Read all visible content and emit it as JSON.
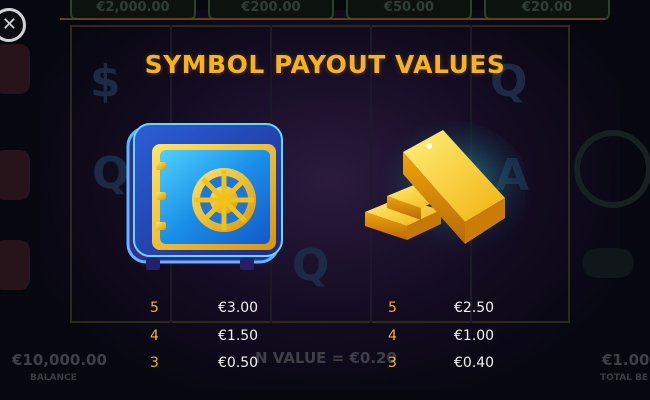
{
  "background": {
    "jackpots": [
      "€2,000.00",
      "€200.00",
      "€50.00",
      "€20.00"
    ],
    "balance_value": "€10,000.00",
    "balance_label": "BALANCE",
    "win_text": "N VALUE = €0.20",
    "total_bet_value": "€1.00",
    "total_bet_label": "TOTAL BE"
  },
  "overlay": {
    "title": "SYMBOL PAYOUT VALUES",
    "symbols": [
      {
        "icon": "safe-icon",
        "payouts": [
          {
            "count": "5",
            "value": "€3.00"
          },
          {
            "count": "4",
            "value": "€1.50"
          },
          {
            "count": "3",
            "value": "€0.50"
          }
        ]
      },
      {
        "icon": "gold-bars-icon",
        "payouts": [
          {
            "count": "5",
            "value": "€2.50"
          },
          {
            "count": "4",
            "value": "€1.00"
          },
          {
            "count": "3",
            "value": "€0.40"
          }
        ]
      }
    ]
  },
  "colors": {
    "accent_gold": "#f6b41a",
    "value_text": "#f1f1f1",
    "safe_blue": "#1e7fe6",
    "safe_gold": "#f2c21c"
  }
}
